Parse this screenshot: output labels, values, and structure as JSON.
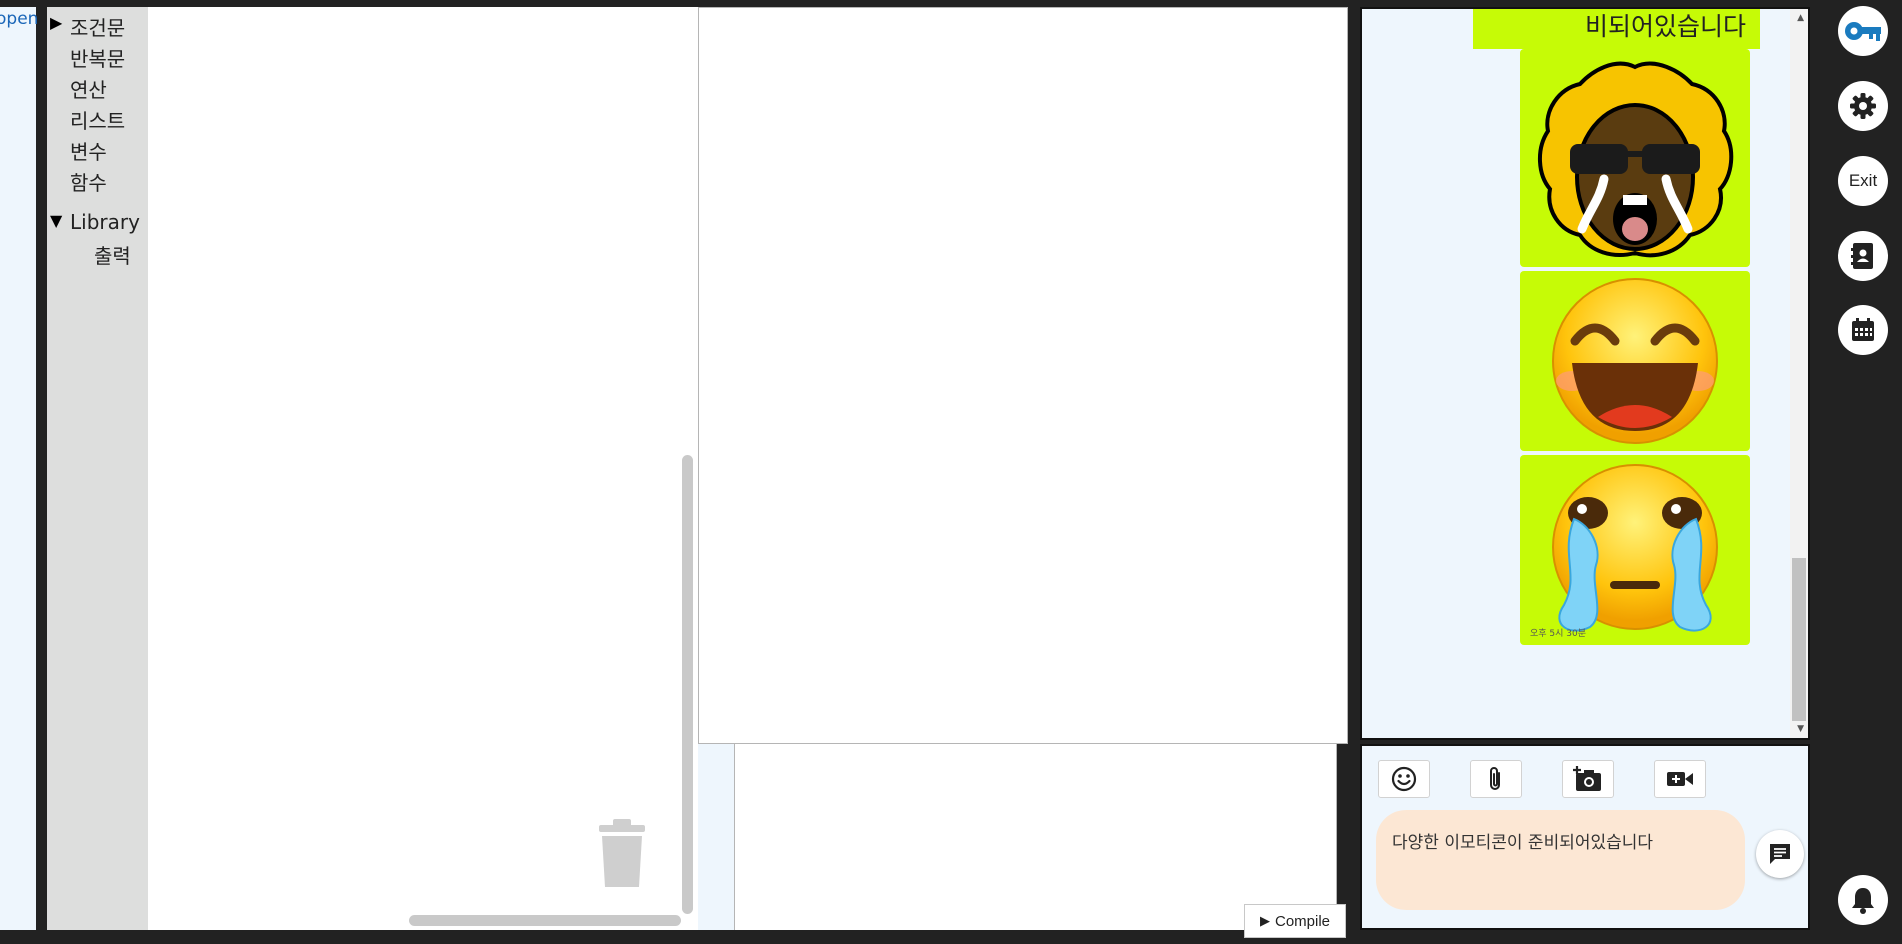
{
  "left_panel": {
    "open_label": "open"
  },
  "toolbox": {
    "categories": [
      {
        "label": "조건문",
        "arrow": "▶"
      },
      {
        "label": "반복문"
      },
      {
        "label": "연산"
      },
      {
        "label": "리스트"
      },
      {
        "label": "변수"
      },
      {
        "label": "함수"
      },
      {
        "label": "Library",
        "arrow": "▼"
      },
      {
        "label": "출력"
      }
    ]
  },
  "editor": {
    "compile_label": "Compile",
    "compile_icon": "▶"
  },
  "chat": {
    "last_text_message": "비되어있습니다",
    "emoticons": [
      {
        "name": "afro-sunglasses-crying-emoticon"
      },
      {
        "name": "laughing-emoticon"
      },
      {
        "name": "crying-emoticon"
      }
    ],
    "message_time": "오후 5시 30분",
    "bubble_color": "#c6fb06",
    "input_text": "다양한 이모티콘이 준비되어있습니다",
    "tools": [
      "emoji-icon",
      "paperclip-icon",
      "camera-plus-icon",
      "video-plus-icon"
    ]
  },
  "sidebar": {
    "exit_label": "Exit",
    "buttons": [
      "key-icon",
      "gear-icon",
      "exit-button",
      "contacts-icon",
      "calendar-icon",
      "bell-icon"
    ]
  },
  "colors": {
    "accent_key": "#1a7bbf",
    "input_bg": "#fce7d4",
    "panel_bg": "#eef6fd"
  }
}
